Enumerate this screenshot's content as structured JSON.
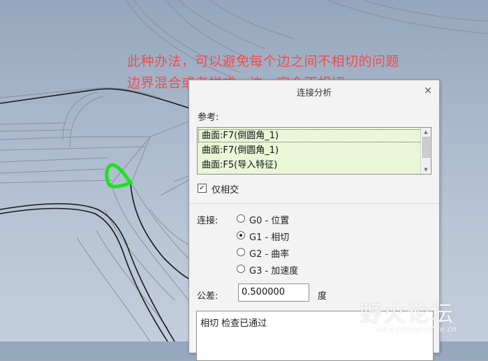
{
  "annotation": {
    "line1": "此种办法，可以避免每个边之间不相切的问题",
    "line2": "边界混合或者样式，边一定会不相切。"
  },
  "dialog": {
    "title": "连接分析",
    "close_glyph": "×",
    "references_label": "参考:",
    "references": [
      "曲面:F7(倒圆角_1)",
      "曲面:F7(倒圆角_1)",
      "曲面:F5(导入特征)"
    ],
    "intersect_only_label": "仅相交",
    "intersect_only_checked": true,
    "connection_label": "连接:",
    "connection_options": [
      "G0 - 位置",
      "G1 - 相切",
      "G2 - 曲率",
      "G3 - 加速度"
    ],
    "connection_selected_index": 1,
    "tolerance_label": "公差:",
    "tolerance_value": "0.500000",
    "tolerance_unit": "度",
    "result_text": "相切 检查已通过"
  },
  "watermark": {
    "title": "野火论坛",
    "url": "www.proewildfire.cn"
  },
  "colors": {
    "annotation": "#ee4a4a",
    "reference_highlight": "#e9f7d7",
    "marker_green": "#20e020"
  }
}
